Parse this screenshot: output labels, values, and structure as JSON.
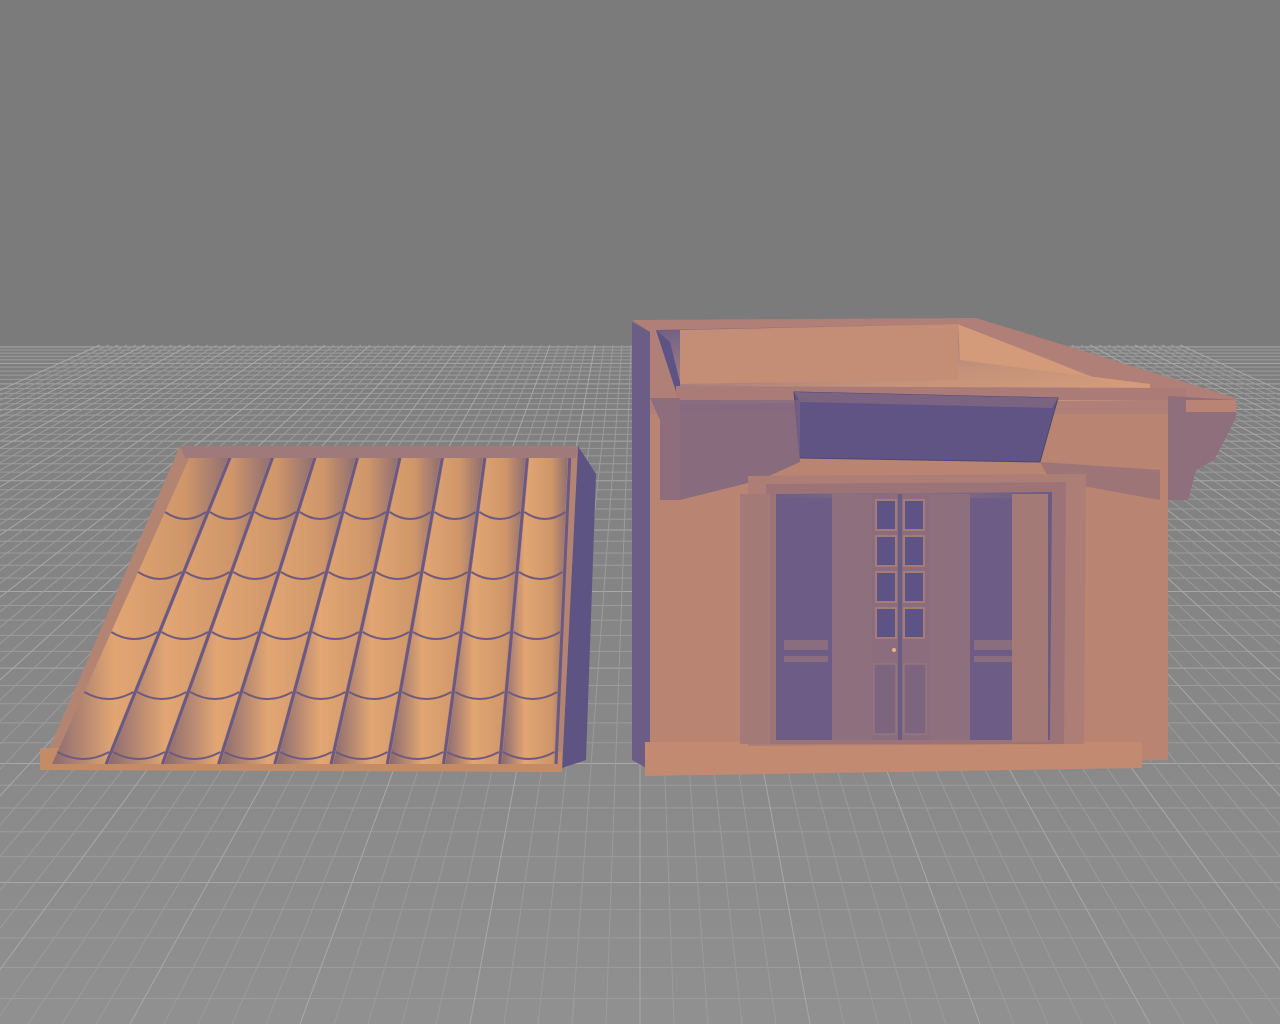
{
  "viewer": {
    "background": "#7b7b7b",
    "floor_color": "#8a8a8a",
    "grid_minor_color": "#9a9a9a",
    "grid_major_color": "#a6a6a6"
  },
  "scene": {
    "objects": [
      {
        "name": "roof-panel",
        "kind": "tiled roof piece",
        "base_color": "#c99469",
        "shadow_color": "#5e5483"
      },
      {
        "name": "building-body",
        "kind": "open-top building shell with double door",
        "base_color": "#b88670",
        "shadow_color": "#5f5584"
      }
    ]
  }
}
